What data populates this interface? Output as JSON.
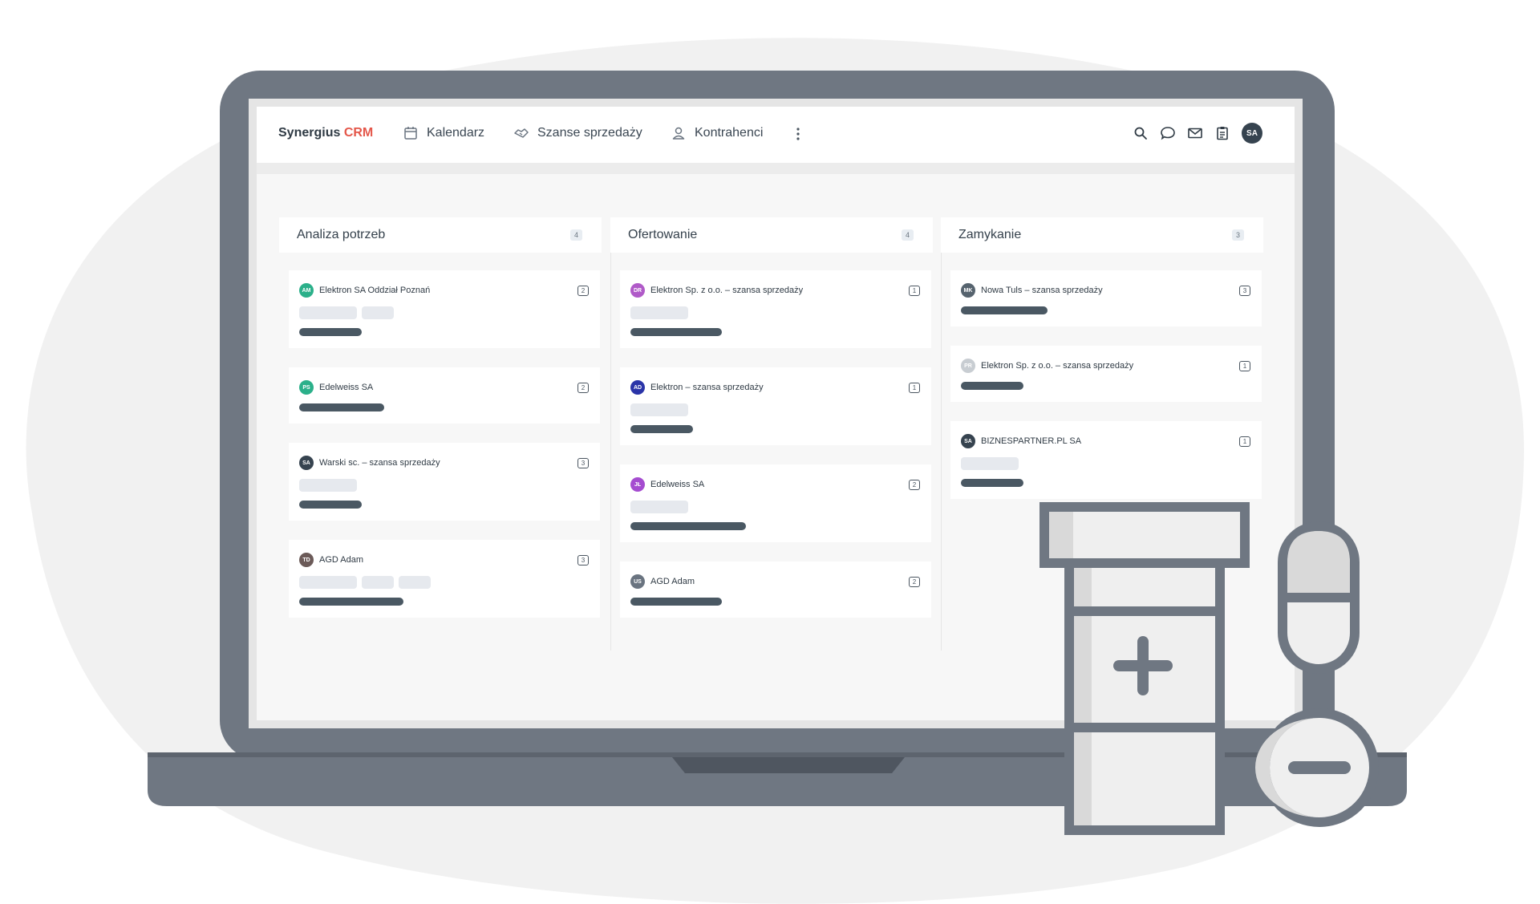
{
  "app": {
    "brand_main": "Synergius ",
    "brand_accent": "CRM"
  },
  "nav": {
    "items": [
      {
        "label": "Kalendarz",
        "icon": "calendar-icon"
      },
      {
        "label": "Szanse sprzedaży",
        "icon": "handshake-icon"
      },
      {
        "label": "Kontrahenci",
        "icon": "person-icon"
      }
    ],
    "more_icon": "vertical-dots-icon",
    "right_icons": [
      "search-icon",
      "chat-icon",
      "mail-icon",
      "clipboard-icon"
    ],
    "user_initials": "SA"
  },
  "columns": [
    {
      "title": "Analiza potrzeb",
      "count": "4",
      "cards": [
        {
          "initials": "AM",
          "avatar_color": "#2bb08a",
          "name": "Elektron SA Oddział Poznań",
          "badge": "2",
          "pills": 2
        },
        {
          "initials": "PS",
          "avatar_color": "#2bb08a",
          "name": "Edelweiss SA",
          "badge": "2",
          "pills": 0
        },
        {
          "initials": "SA",
          "avatar_color": "#36434f",
          "name": "Warski sc. – szansa sprzedaży",
          "badge": "3",
          "pills": 1
        },
        {
          "initials": "TD",
          "avatar_color": "#6b5a58",
          "name": "AGD Adam",
          "badge": "3",
          "pills": 3
        }
      ]
    },
    {
      "title": "Ofertowanie",
      "count": "4",
      "cards": [
        {
          "initials": "DR",
          "avatar_color": "#b05ac8",
          "name": "Elektron Sp. z o.o. – szansa sprzedaży",
          "badge": "1",
          "pills": 1
        },
        {
          "initials": "AD",
          "avatar_color": "#2a34a8",
          "name": "Elektron – szansa sprzedaży",
          "badge": "1",
          "pills": 1
        },
        {
          "initials": "JŁ",
          "avatar_color": "#a54cd0",
          "name": "Edelweiss SA",
          "badge": "2",
          "pills": 1
        },
        {
          "initials": "US",
          "avatar_color": "#6a7480",
          "name": "AGD Adam",
          "badge": "2",
          "pills": 0
        }
      ]
    },
    {
      "title": "Zamykanie",
      "count": "3",
      "cards": [
        {
          "initials": "MK",
          "avatar_color": "#56636e",
          "name": "Nowa Tuls – szansa sprzedaży",
          "badge": "3",
          "pills": 0
        },
        {
          "initials": "PR",
          "avatar_color": "#c8cdd2",
          "name": "Elektron Sp. z o.o. – szansa sprzedaży",
          "badge": "1",
          "pills": 0
        },
        {
          "initials": "SA",
          "avatar_color": "#36434f",
          "name": "BIZNESPARTNER.PL SA",
          "badge": "1",
          "pills": 1
        }
      ]
    }
  ],
  "colors": {
    "laptop_frame": "#6f7782",
    "accent": "#e4574a",
    "progress_bar": "#4a5863",
    "background_blob": "#f1f1f1"
  },
  "illustration": {
    "items": [
      "medicine-bottle-icon",
      "capsule-icon",
      "tablet-icon"
    ]
  }
}
